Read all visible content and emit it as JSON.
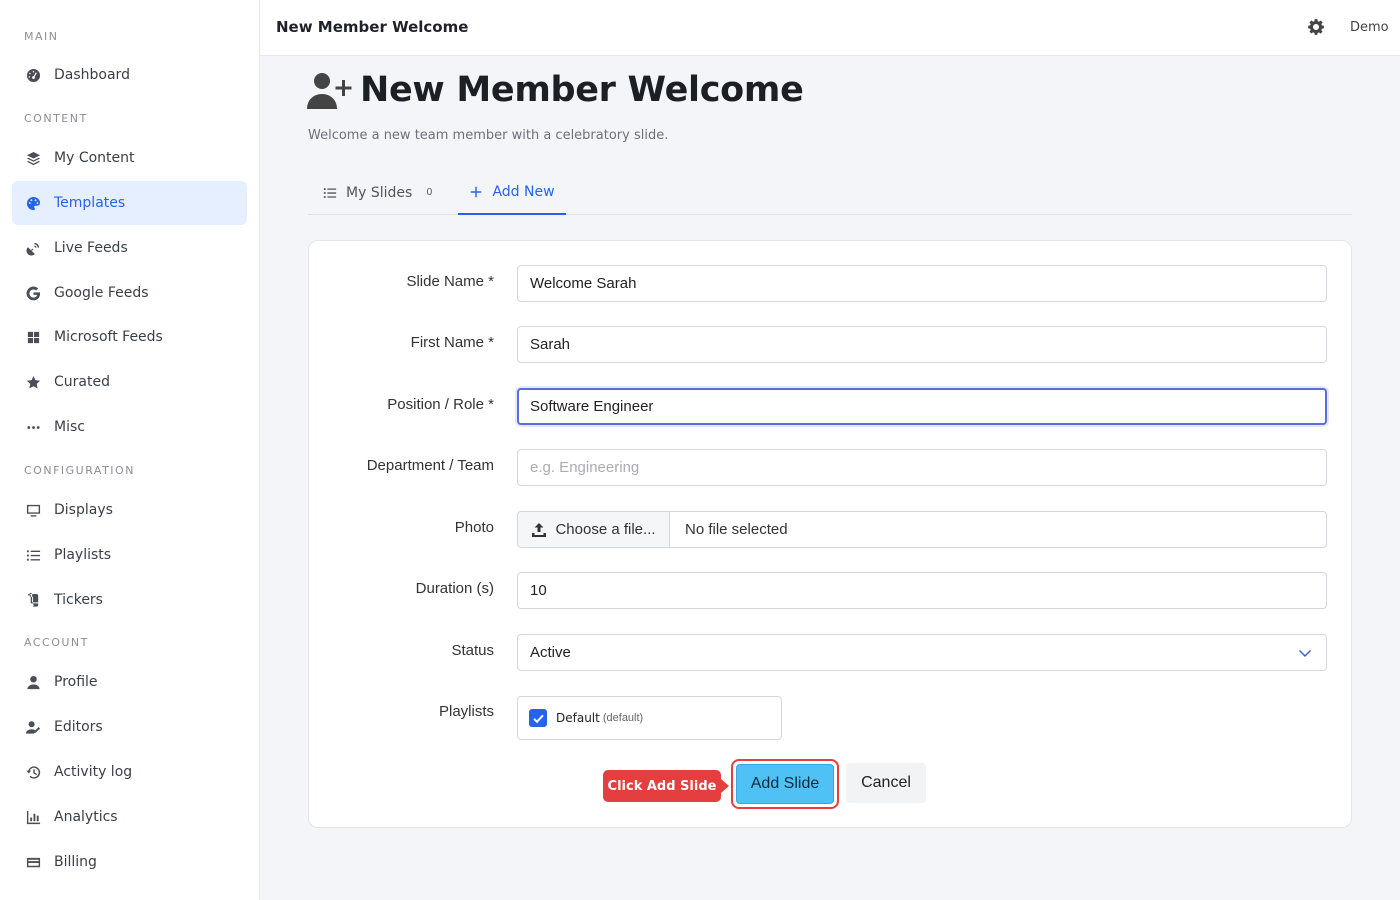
{
  "sidebar": {
    "sections": [
      "MAIN",
      "CONTENT",
      "CONFIGURATION",
      "ACCOUNT"
    ],
    "items": [
      {
        "label": "Dashboard",
        "icon": "dashboard-icon"
      },
      {
        "label": "My Content",
        "icon": "layers-icon"
      },
      {
        "label": "Templates",
        "icon": "palette-icon",
        "active": true
      },
      {
        "label": "Live Feeds",
        "icon": "satellite-dish-icon"
      },
      {
        "label": "Google Feeds",
        "icon": "google-icon"
      },
      {
        "label": "Microsoft Feeds",
        "icon": "windows-icon"
      },
      {
        "label": "Curated",
        "icon": "star-icon"
      },
      {
        "label": "Misc",
        "icon": "ellipsis-icon"
      },
      {
        "label": "Displays",
        "icon": "monitor-icon"
      },
      {
        "label": "Playlists",
        "icon": "list-icon"
      },
      {
        "label": "Tickers",
        "icon": "scroll-icon"
      },
      {
        "label": "Profile",
        "icon": "user-icon"
      },
      {
        "label": "Editors",
        "icon": "user-edit-icon"
      },
      {
        "label": "Activity log",
        "icon": "history-icon"
      },
      {
        "label": "Analytics",
        "icon": "chart-icon"
      },
      {
        "label": "Billing",
        "icon": "credit-card-icon"
      }
    ]
  },
  "topbar": {
    "title": "New Member Welcome",
    "user": "Demo"
  },
  "page": {
    "title": "New Member Welcome",
    "subtitle": "Welcome a new team member with a celebratory slide."
  },
  "tabs": {
    "my_slides": {
      "label": "My Slides",
      "count": "0"
    },
    "add_new": {
      "label": "Add New"
    }
  },
  "form": {
    "slide_name": {
      "label": "Slide Name *",
      "value": "Welcome Sarah"
    },
    "first_name": {
      "label": "First Name *",
      "value": "Sarah"
    },
    "position": {
      "label": "Position / Role *",
      "value": "Software Engineer"
    },
    "department": {
      "label": "Department / Team",
      "value": "",
      "placeholder": "e.g. Engineering"
    },
    "photo": {
      "label": "Photo",
      "button": "Choose a file...",
      "filename": "No file selected"
    },
    "duration": {
      "label": "Duration (s)",
      "value": "10"
    },
    "status": {
      "label": "Status",
      "value": "Active"
    },
    "playlists": {
      "label": "Playlists",
      "item": "Default",
      "tag": "(default)",
      "checked": true
    }
  },
  "actions": {
    "callout": "Click Add Slide",
    "add": "Add Slide",
    "cancel": "Cancel"
  },
  "colors": {
    "accent": "#2563eb",
    "primary_button": "#4fc1f5",
    "highlight": "#e53e3e"
  }
}
